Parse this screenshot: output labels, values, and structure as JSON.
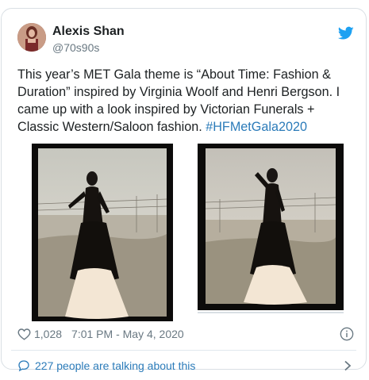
{
  "author": {
    "name": "Alexis Shan",
    "handle": "@70s90s"
  },
  "tweet": {
    "text_main": "This year’s MET Gala theme is “About Time: Fashion & Duration” inspired by Virginia Woolf and Henri Bergson. I came up with a look inspired by Victorian Funerals + Classic Western/Saloon fashion. ",
    "hashtag": "#HFMetGala2020"
  },
  "meta": {
    "like_count": "1,028",
    "timestamp": "7:01 PM - May 4, 2020"
  },
  "conversation": {
    "label": "227 people are talking about this"
  },
  "icons": {
    "brand": "twitter-bird-icon",
    "like": "heart-icon",
    "info": "info-icon",
    "conversation": "speech-bubble-icon",
    "more": "chevron-right-icon"
  },
  "colors": {
    "link": "#2b7bb9",
    "brand": "#1da1f2",
    "muted": "#697882",
    "text": "#1c2022"
  }
}
